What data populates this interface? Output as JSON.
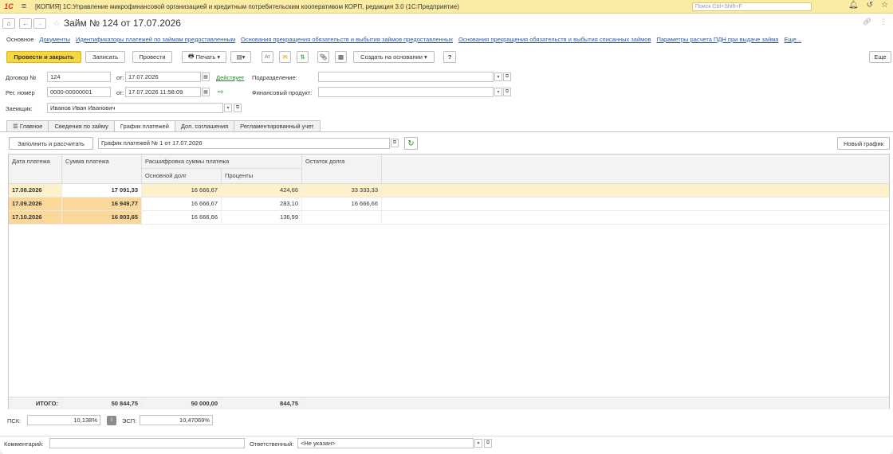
{
  "titlebar": {
    "title": "[КОПИЯ] 1С:Управление микрофинансовой организацией и кредитным потребительским кооперативом КОРП, редакция 3.0  (1С:Предприятие)",
    "search_placeholder": "Поиск Ctrl+Shift+F"
  },
  "document": {
    "title": "Займ № 124 от 17.07.2026"
  },
  "links": [
    "Основное",
    "Документы",
    "Идентификаторы платежей по займам предоставленным",
    "Основания прекращения обязательств и выбытия займов предоставленных",
    "Основания прекращения обязательств и выбытия списанных займов",
    "Параметры расчета ПДН при выдаче займа",
    "Еще..."
  ],
  "toolbar": {
    "post_close": "Провести и закрыть",
    "write": "Записать",
    "post": "Провести",
    "print": "Печать",
    "create_based": "Создать на основании",
    "help": "?",
    "more": "Еще"
  },
  "form": {
    "contract_label": "Договор №",
    "contract_value": "124",
    "from_label": "от:",
    "contract_date": "17.07.2026",
    "status_link": "Действует",
    "division_label": "Подразделение:",
    "division_value": "",
    "reg_label": "Рег. номер",
    "reg_value": "0000-00000001",
    "reg_date": "17.07.2026 11:58:09",
    "product_label": "Финансовый продукт:",
    "product_value": "",
    "borrower_label": "Заемщик:",
    "borrower_value": "Иванов Иван Иванович"
  },
  "tabs": [
    "Главное",
    "Сведения по займу",
    "График платежей",
    "Доп. соглашения",
    "Регламентированный учет"
  ],
  "schedule_bar": {
    "fill_button": "Заполнить и рассчитать",
    "schedule_value": "График платежей № 1 от 17.07.2026",
    "new_button": "Новый график"
  },
  "table": {
    "headers": {
      "date": "Дата платежа",
      "amount": "Сумма платежа",
      "breakdown": "Расшифровка суммы платежа",
      "principal": "Основной долг",
      "interest": "Проценты",
      "balance": "Остаток долга"
    },
    "rows": [
      {
        "date": "17.08.2026",
        "amount": "17 091,33",
        "principal": "16 666,67",
        "interest": "424,66",
        "balance": "33 333,33"
      },
      {
        "date": "17.09.2026",
        "amount": "16 949,77",
        "principal": "16 666,67",
        "interest": "283,10",
        "balance": "16 666,66"
      },
      {
        "date": "17.10.2026",
        "amount": "16 803,65",
        "principal": "16 666,66",
        "interest": "136,99",
        "balance": ""
      }
    ],
    "totals": {
      "label": "ИТОГО:",
      "amount": "50 844,75",
      "principal": "50 000,00",
      "interest": "844,75"
    }
  },
  "rates": {
    "psk_label": "ПСК:",
    "psk_value": "10,138%",
    "esp_label": "ЭСП:",
    "esp_value": "10,47069%"
  },
  "footer": {
    "comment_label": "Комментарий:",
    "comment_value": "",
    "responsible_label": "Ответственный:",
    "responsible_value": "<Не указан>"
  },
  "colors": {
    "accent": "#f7d740",
    "titlebar": "#fbeca4",
    "row_selected": "#fdf1cc",
    "link": "#2d5aa5"
  }
}
